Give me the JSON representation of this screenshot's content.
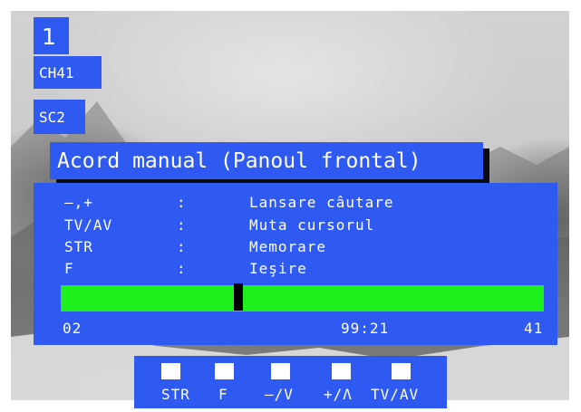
{
  "channel": {
    "number": "1",
    "name": "CH41",
    "sound_mode": "SC2"
  },
  "menu": {
    "title": "Acord manual (Panoul frontal)",
    "rows": [
      {
        "key": "–,+",
        "sep": ":",
        "action": "Lansare câutare"
      },
      {
        "key": "TV/AV",
        "sep": ":",
        "action": "Muta cursorul"
      },
      {
        "key": "STR",
        "sep": ":",
        "action": "Memorare"
      },
      {
        "key": "F",
        "sep": ":",
        "action": "Ieşire"
      }
    ],
    "tuning": {
      "position": 0.365,
      "band_label": "02",
      "frequency": "99:21",
      "channel_label": "41"
    }
  },
  "keys": [
    {
      "label": "STR"
    },
    {
      "label": "F"
    },
    {
      "label": "–/V"
    },
    {
      "label": "+/Λ"
    },
    {
      "label": "TV/AV"
    }
  ],
  "colors": {
    "osd_blue": "#2f5af2",
    "bar_green": "#1ef01e",
    "cursor": "#000000",
    "text": "#ffffff"
  }
}
